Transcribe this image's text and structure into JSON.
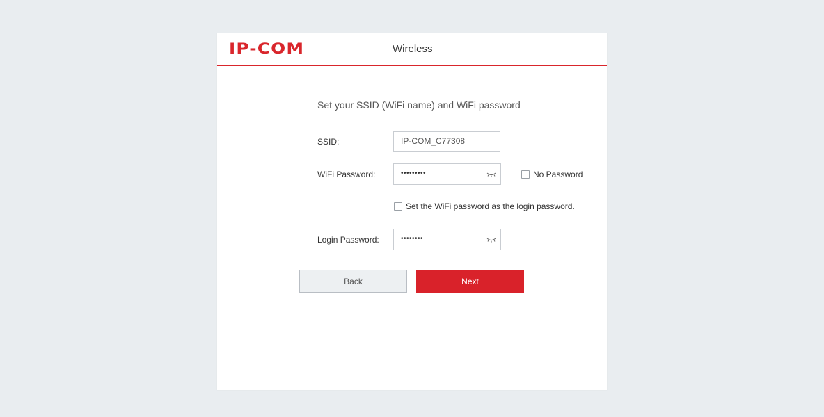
{
  "header": {
    "logo_text": "IP-COM",
    "title": "Wireless"
  },
  "form": {
    "subtitle": "Set your SSID (WiFi name) and WiFi password",
    "ssid": {
      "label": "SSID:",
      "value": "IP-COM_C77308"
    },
    "wifi_password": {
      "label": "WiFi Password:",
      "masked_value": "•••••••••",
      "no_password_label": "No Password",
      "no_password_checked": false
    },
    "same_as_login": {
      "label": "Set the WiFi password as the login password.",
      "checked": false
    },
    "login_password": {
      "label": "Login Password:",
      "masked_value": "••••••••"
    }
  },
  "buttons": {
    "back_label": "Back",
    "next_label": "Next"
  },
  "colors": {
    "brand": "#d9262c",
    "next_button": "#d9222a",
    "page_background": "#e9edf0"
  },
  "icons": {
    "password_toggle": "eye-closed-icon"
  }
}
